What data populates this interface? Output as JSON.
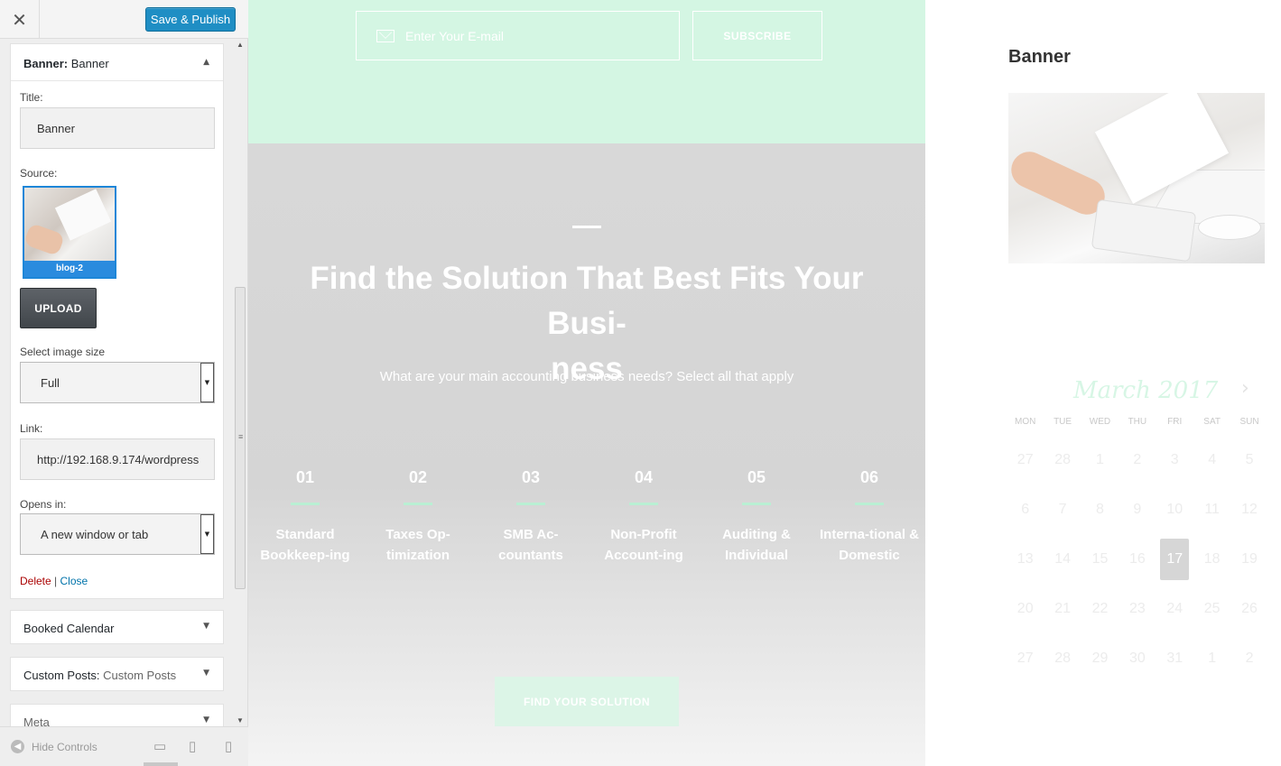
{
  "sidebar": {
    "close_glyph": "✕",
    "save_publish": "Save & Publish",
    "banner_widget": {
      "head_type": "Banner:",
      "head_name": "Banner",
      "title_label": "Title:",
      "title_value": "Banner",
      "source_label": "Source:",
      "thumb_caption": "blog-2",
      "upload": "UPLOAD",
      "size_label": "Select image size",
      "size_value": "Full",
      "link_label": "Link:",
      "link_value": "http://192.168.9.174/wordpress",
      "opens_label": "Opens in:",
      "opens_value": "A new window or tab",
      "delete": "Delete",
      "separator": "|",
      "close": "Close"
    },
    "widgets": [
      {
        "type": "Booked Calendar",
        "name": ""
      },
      {
        "type": "Custom Posts:",
        "name": "Custom Posts"
      },
      {
        "type": "Meta",
        "name": ""
      }
    ],
    "footer": {
      "hide_controls": "Hide Controls"
    }
  },
  "preview": {
    "email_placeholder": "Enter Your E-mail",
    "subscribe": "SUBSCRIBE",
    "hero_title": "Find the Solution That Best Fits Your Busi-ness",
    "hero_title_line1": "Find the Solution That Best Fits Your Busi-",
    "hero_title_line2": "ness",
    "hero_subtitle": "What are your main accounting business needs? Select all that apply",
    "steps": [
      {
        "num": "01",
        "label": "Standard Bookkeep-ing"
      },
      {
        "num": "02",
        "label": "Taxes Op-timization"
      },
      {
        "num": "03",
        "label": "SMB Ac-countants"
      },
      {
        "num": "04",
        "label": "Non-Profit Account-ing"
      },
      {
        "num": "05",
        "label": "Auditing & Individual"
      },
      {
        "num": "06",
        "label": "Interna-tional & Domestic"
      }
    ],
    "find_button": "FIND YOUR SOLUTION"
  },
  "right_sidebar": {
    "banner_title": "Banner",
    "calendar": {
      "month": "March 2017",
      "next": "›",
      "weekdays": [
        "MON",
        "TUE",
        "WED",
        "THU",
        "FRI",
        "SAT",
        "SUN"
      ],
      "weeks": [
        [
          "27",
          "28",
          "1",
          "2",
          "3",
          "4",
          "5"
        ],
        [
          "6",
          "7",
          "8",
          "9",
          "10",
          "11",
          "12"
        ],
        [
          "13",
          "14",
          "15",
          "16",
          "17",
          "18",
          "19"
        ],
        [
          "20",
          "21",
          "22",
          "23",
          "24",
          "25",
          "26"
        ],
        [
          "27",
          "28",
          "29",
          "30",
          "31",
          "1",
          "2"
        ]
      ],
      "today": "17"
    }
  },
  "colors": {
    "accent_blue": "#1f8ec4",
    "mint_band": "#d4f6e3",
    "hero_gray": "#d8d8d8"
  }
}
